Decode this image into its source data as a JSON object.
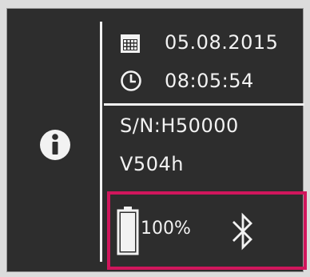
{
  "device_info": {
    "date": "05.08.2015",
    "time": "08:05:54",
    "serial_number": "S/N:H50000",
    "version": "V504h"
  },
  "status": {
    "battery_level": "100%",
    "battery_fraction": 1.0,
    "bluetooth_icon": "bluetooth-icon"
  },
  "icons": {
    "info": "info-icon",
    "calendar": "calendar-icon",
    "clock": "clock-icon",
    "battery": "battery-icon"
  },
  "colors": {
    "screen_background": "#2d2d2d",
    "foreground": "#f2f2f2",
    "highlight_border": "#d0165c"
  }
}
